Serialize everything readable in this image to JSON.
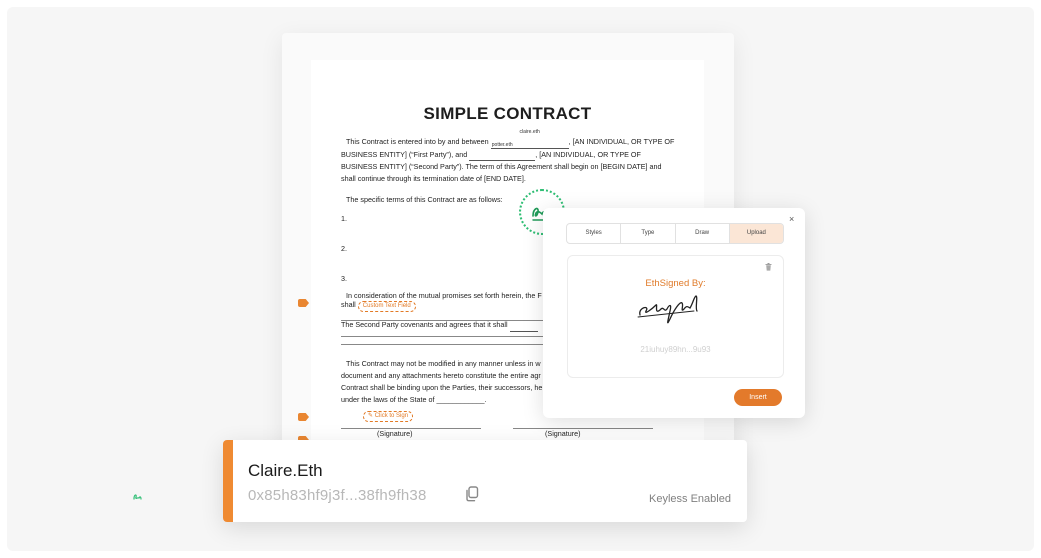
{
  "document": {
    "title": "SIMPLE CONTRACT",
    "para1_a": "This Contract is entered into by and between",
    "first_party": "claire.eth",
    "para1_b": ", [AN INDIVIDUAL, OR TYPE OF",
    "para1_c": "BUSINESS ENTITY] (“First Party”), and",
    "second_party": "potter.eth",
    "para1_d": ", [AN INDIVIDUAL, OR TYPE OF",
    "para1_e": "BUSINESS ENTITY] (“Second Party”).   The term of this Agreement shall begin on [BEGIN DATE] and",
    "para1_f": "shall continue through its termination date of [END DATE].",
    "terms_intro": "The specific terms of this Contract are as follows:",
    "item1": "1.",
    "item2": "2.",
    "item3": "3.",
    "consideration": "In consideration of the mutual promises set forth herein, the F",
    "shall": "shall",
    "custom_text_field": "Custom Text Field",
    "second_party_covenants": "The Second Party covenants and agrees that it shall",
    "modify_1": "This Contract may not be modified in any manner unless in w",
    "modify_2": "document and any attachments hereto constitute the entire agr",
    "modify_3": "Contract shall be binding upon the Parties, their successors, he",
    "modify_4": "under the laws of the State of ____________.",
    "click_to_sign": "Click to Sign",
    "signature_label_left": "(Signature)",
    "signature_label_right": "(Signature)"
  },
  "signature_modal": {
    "close_label": "×",
    "tabs": [
      "Styles",
      "Type",
      "Draw",
      "Upload"
    ],
    "active_tab": "Upload",
    "signed_by": "EthSigned By:",
    "address": "21iuhuy89hn...9u93",
    "insert_label": "Insert"
  },
  "identity_card": {
    "name": "Claire.Eth",
    "address": "0x85h83hf9j3f...38fh9fh38",
    "status": "Keyless Enabled"
  },
  "colors": {
    "accent_orange": "#ef8a32",
    "stamp_green": "#2fbe74"
  },
  "icons": {
    "copy": "copy-icon",
    "trash": "trash-icon",
    "close": "close-icon",
    "stamp": "signature-stamp-icon"
  }
}
